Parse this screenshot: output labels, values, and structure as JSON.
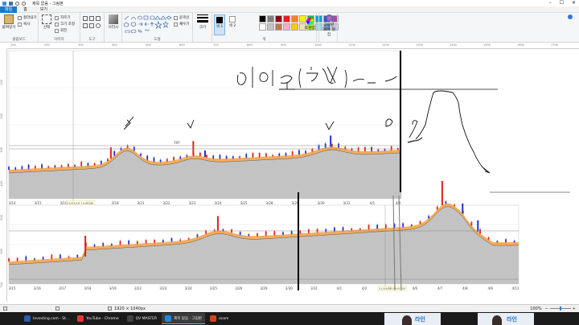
{
  "window": {
    "title": "제목 없음 - 그림판"
  },
  "menu": {
    "file": "파일",
    "home": "홈",
    "view": "보기"
  },
  "ribbon": {
    "clipboard": {
      "paste": "붙여넣기",
      "cut": "잘라내기",
      "copy": "복사",
      "group": "클립보드"
    },
    "image": {
      "select": "선택",
      "crop": "자르기",
      "resize": "크기 조정",
      "rotate": "회전",
      "group": "이미지"
    },
    "tools": {
      "group": "도구"
    },
    "brushes": {
      "label": "브러시"
    },
    "shapes": {
      "outline": "윤곽선",
      "fill": "채우기",
      "group": "도형"
    },
    "size": {
      "label": "크기"
    },
    "colors": {
      "color1": "색 1",
      "color2": "색 2",
      "edit": "색 편집",
      "group": "색",
      "palette": [
        "#000000",
        "#7f7f7f",
        "#880015",
        "#ed1c24",
        "#ff7f27",
        "#fff200",
        "#22b14c",
        "#00a2e8",
        "#3f48cc",
        "#a349a4",
        "#ffffff",
        "#c3c3c3",
        "#b97a57",
        "#ffaec9",
        "#ffc90e",
        "#efe4b0",
        "#b5e61d",
        "#99d9ea",
        "#7092be",
        "#c8bfe7"
      ]
    },
    "paint3d": {
      "label": "그림판 3D로 편집"
    }
  },
  "ruler": {
    "top": [
      "100",
      "200",
      "300",
      "400",
      "500",
      "600",
      "700",
      "800",
      "900",
      "1000",
      "1100",
      "1200",
      "1300",
      "1400",
      "1500",
      "1600",
      "1700"
    ],
    "left": [
      "100",
      "200",
      "300",
      "400",
      "500",
      "600",
      "700"
    ]
  },
  "chart_top": {
    "dates": [
      "3/14",
      "3/15",
      "3/16",
      "3/17",
      "3/18",
      "3/21",
      "3/22",
      "3/23",
      "3/24",
      "3/25",
      "3/28",
      "3/29",
      "3/30",
      "3/31",
      "4/1",
      "4/4"
    ],
    "crosshair_label": "22/03/16 14:00:00",
    "price_label": "797"
  },
  "chart_bottom": {
    "dates": [
      "3/15",
      "3/16",
      "3/17",
      "3/18",
      "3/19",
      "3/22",
      "3/23",
      "3/24",
      "3/25",
      "3/26",
      "3/29",
      "3/30",
      "3/31",
      "4/1",
      "4/2",
      "4/5",
      "4/6",
      "4/7",
      "4/8",
      "4/9",
      "4/12"
    ],
    "crosshair_label": "21/04/06 09:00:00"
  },
  "statusbar": {
    "size": "1920 × 1040px",
    "zoom": "100%"
  },
  "taskbar": {
    "items": [
      {
        "label": "Investing.com - St...",
        "color": "#2c5ca8"
      },
      {
        "label": "YouTube - Chrome",
        "color": "#e53935"
      },
      {
        "label": "QV MASTER",
        "color": "#444444"
      },
      {
        "label": "제목 없음 - 그림판",
        "color": "#1e88e5"
      },
      {
        "label": "ocam",
        "color": "#d84315"
      }
    ]
  },
  "thumbnails": {
    "left": "라인",
    "right": "라인"
  }
}
